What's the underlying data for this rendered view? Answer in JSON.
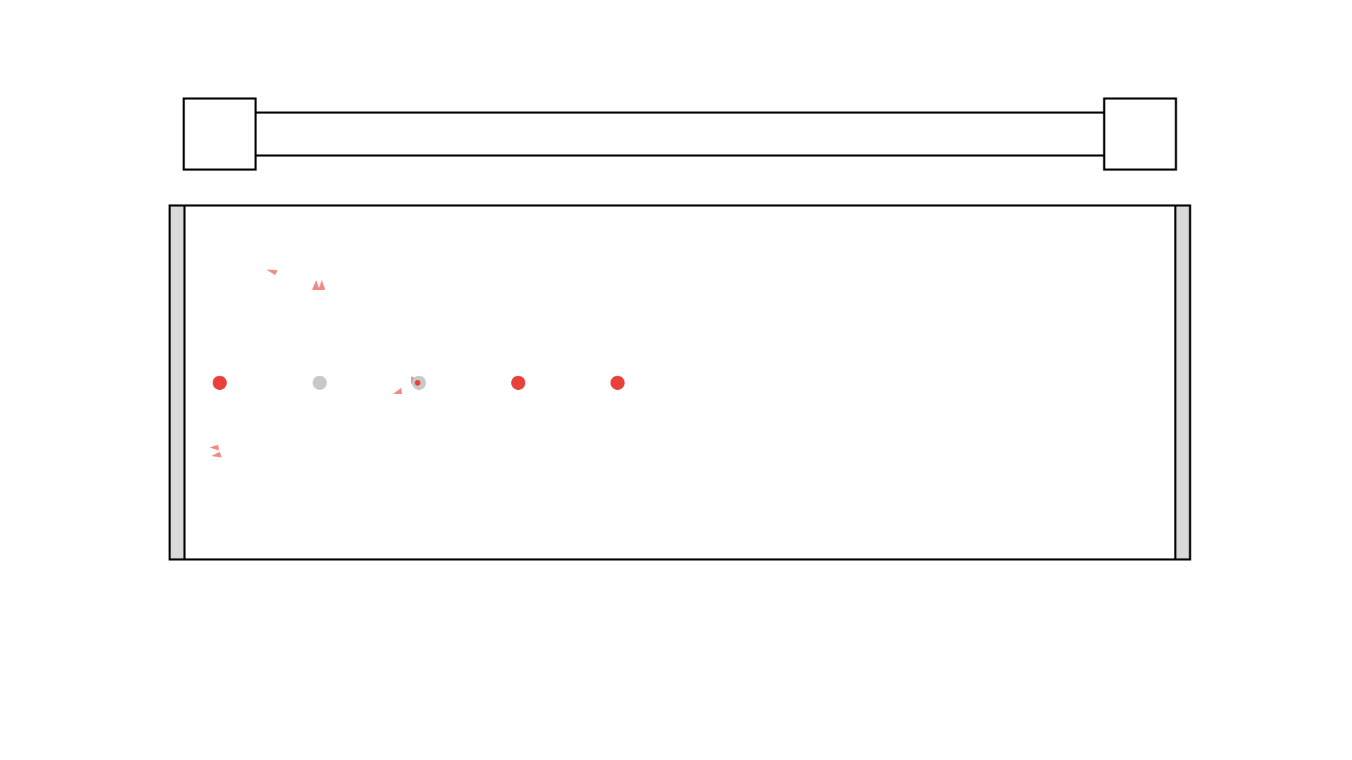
{
  "colors": {
    "background": "#ffffff",
    "outline": "#000000",
    "bumper": "#d9d9d9",
    "active_ball": "#e8403a",
    "inactive_ball": "#c8c8c8",
    "particle": "#ef8a86"
  },
  "rail": {
    "left_box": "left-rail-block",
    "right_box": "right-rail-block",
    "track": "rail-track"
  },
  "arena": {
    "left_bumper": "left-bumper-wall",
    "right_bumper": "right-bumper-wall"
  },
  "balls": [
    {
      "id": "ball-1",
      "state": "active"
    },
    {
      "id": "ball-2",
      "state": "inactive"
    },
    {
      "id": "ball-3",
      "state": "inactive-hit"
    },
    {
      "id": "ball-4",
      "state": "active"
    },
    {
      "id": "ball-5",
      "state": "active"
    }
  ],
  "particle_count": 10
}
